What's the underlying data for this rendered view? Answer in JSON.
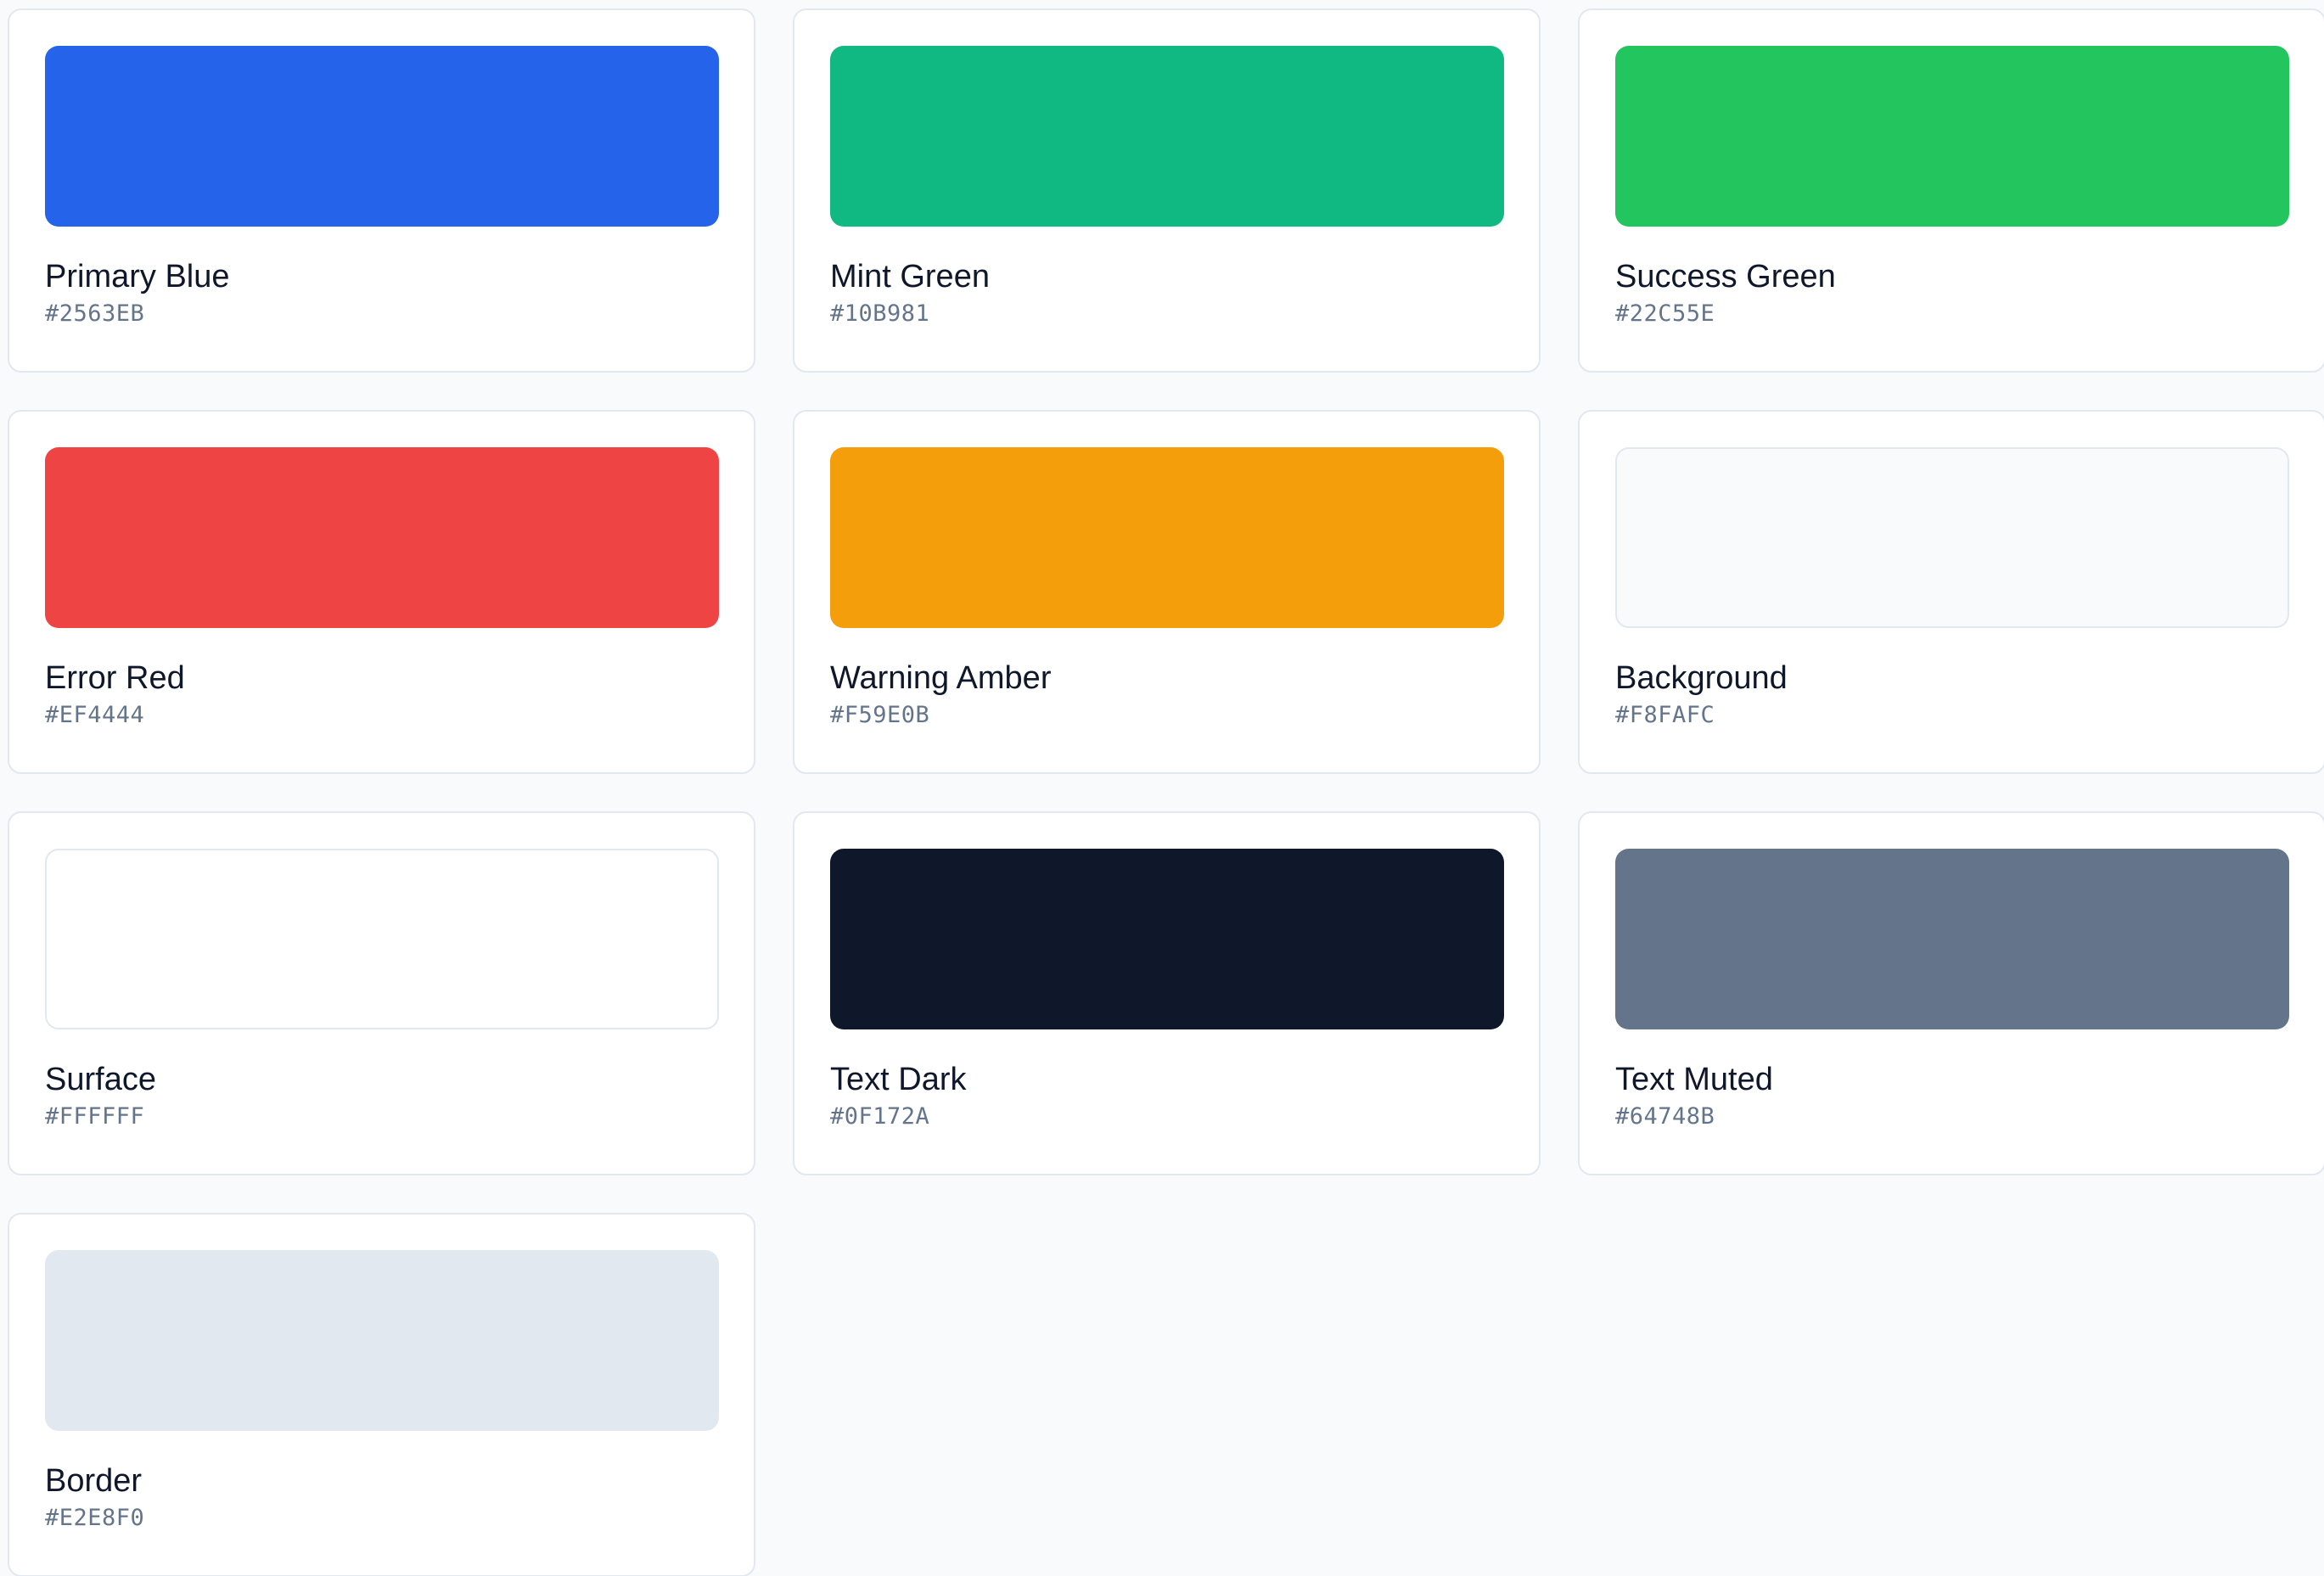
{
  "palette": [
    {
      "name": "Primary Blue",
      "hex": "#2563EB",
      "color": "#2563EB"
    },
    {
      "name": "Mint Green",
      "hex": "#10B981",
      "color": "#10B981"
    },
    {
      "name": "Success Green",
      "hex": "#22C55E",
      "color": "#22C55E"
    },
    {
      "name": "Error Red",
      "hex": "#EF4444",
      "color": "#EF4444"
    },
    {
      "name": "Warning Amber",
      "hex": "#F59E0B",
      "color": "#F59E0B"
    },
    {
      "name": "Background",
      "hex": "#F8FAFC",
      "color": "#F8FAFC"
    },
    {
      "name": "Surface",
      "hex": "#FFFFFF",
      "color": "#FFFFFF"
    },
    {
      "name": "Text Dark",
      "hex": "#0F172A",
      "color": "#0F172A"
    },
    {
      "name": "Text Muted",
      "hex": "#64748B",
      "color": "#64748B"
    },
    {
      "name": "Border",
      "hex": "#E2E8F0",
      "color": "#E2E8F0"
    }
  ]
}
